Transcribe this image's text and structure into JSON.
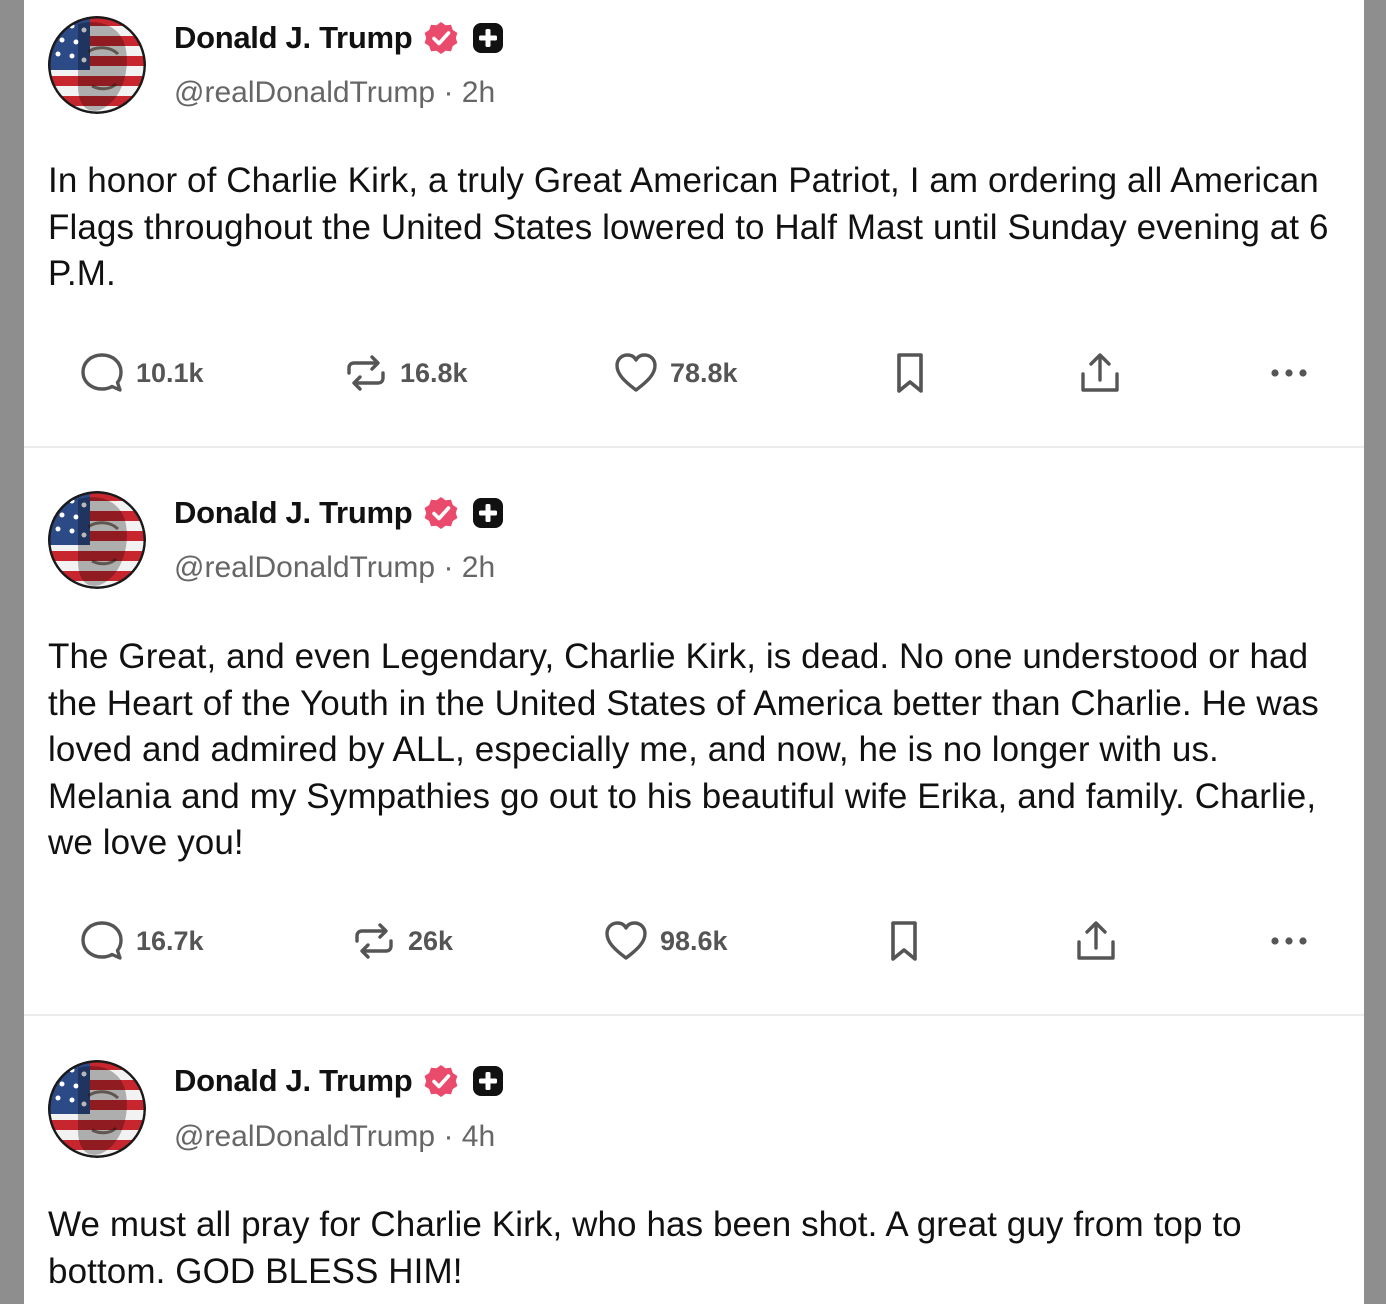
{
  "colors": {
    "verified": "#ea4a6c",
    "icon": "#555555",
    "text": "#111111",
    "muted": "#666666"
  },
  "posts": [
    {
      "author": "Donald J. Trump",
      "handle": "@realDonaldTrump",
      "time": "2h",
      "text": "In honor of Charlie Kirk, a truly Great American Patriot, I am ordering all American Flags throughout the United States lowered to Half Mast until Sunday evening at 6 P.M.",
      "replies": "10.1k",
      "reposts": "16.8k",
      "likes": "78.8k"
    },
    {
      "author": "Donald J. Trump",
      "handle": "@realDonaldTrump",
      "time": "2h",
      "text": "The Great, and even Legendary, Charlie Kirk, is dead. No one understood or had the Heart of the Youth in the United States of America better than Charlie. He was loved and admired by ALL, especially me, and now, he is no longer with us. Melania and my Sympathies go out to his beautiful wife Erika, and family. Charlie, we love you!",
      "replies": "16.7k",
      "reposts": "26k",
      "likes": "98.6k"
    },
    {
      "author": "Donald J. Trump",
      "handle": "@realDonaldTrump",
      "time": "4h",
      "text": "We must all pray for Charlie Kirk, who has been shot. A great guy from top to bottom. GOD BLESS HIM!"
    }
  ],
  "separator": " · ",
  "icons": {
    "avatar": "flag-portrait-avatar",
    "verified": "verified-badge-icon",
    "plus": "plus-badge-icon",
    "reply": "reply-icon",
    "repost": "repost-icon",
    "like": "heart-icon",
    "bookmark": "bookmark-icon",
    "share": "share-icon",
    "more": "more-icon"
  }
}
